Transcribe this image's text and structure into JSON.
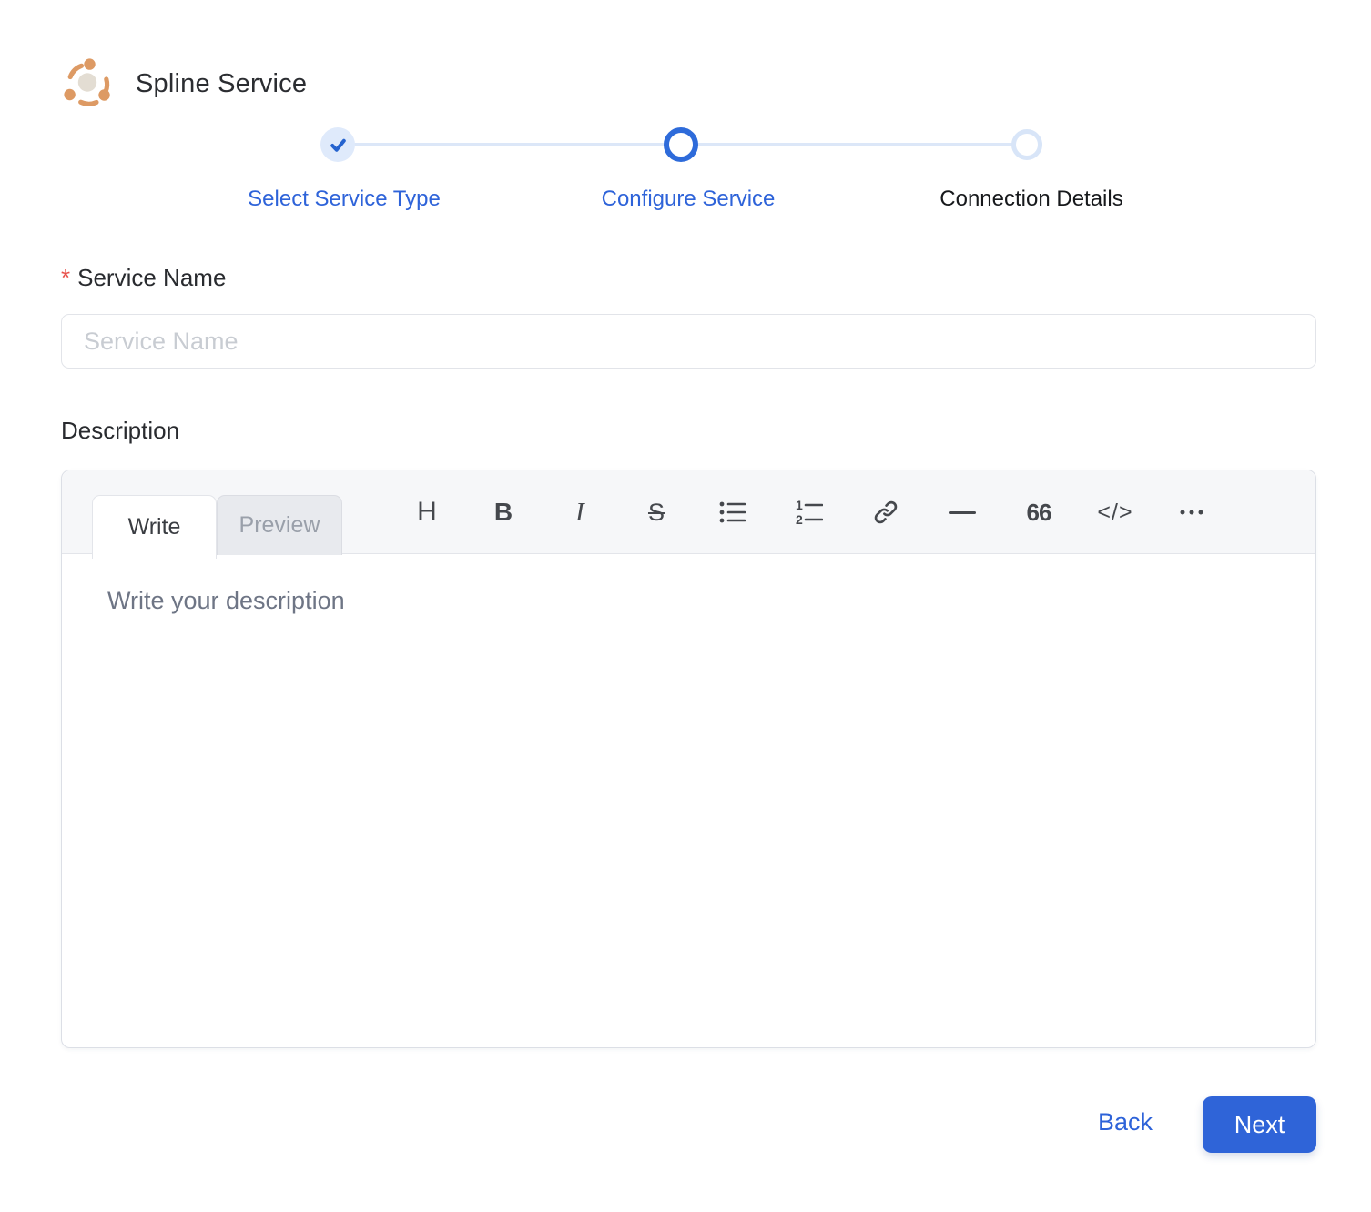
{
  "brand": {
    "title": "Spline Service",
    "logo_icon": "spline-hub-icon"
  },
  "stepper": {
    "steps": [
      {
        "label": "Select Service Type",
        "state": "completed",
        "icon": "check-icon"
      },
      {
        "label": "Configure Service",
        "state": "active",
        "icon": "ring-icon"
      },
      {
        "label": "Connection Details",
        "state": "upcoming",
        "icon": "ring-icon"
      }
    ]
  },
  "form": {
    "service_name": {
      "label": "Service Name",
      "required_marker": "*",
      "placeholder": "Service Name",
      "value": ""
    },
    "description": {
      "label": "Description",
      "editor": {
        "tabs": [
          {
            "label": "Write",
            "active": true
          },
          {
            "label": "Preview",
            "active": false
          }
        ],
        "toolbar": [
          {
            "name": "heading",
            "glyph": "H"
          },
          {
            "name": "bold",
            "glyph": "B"
          },
          {
            "name": "italic",
            "glyph": "I"
          },
          {
            "name": "strikethrough",
            "glyph": "S"
          },
          {
            "name": "unordered-list",
            "glyph": ""
          },
          {
            "name": "ordered-list",
            "glyph": ""
          },
          {
            "name": "link",
            "glyph": ""
          },
          {
            "name": "horizontal-rule",
            "glyph": ""
          },
          {
            "name": "quote",
            "glyph": "66"
          },
          {
            "name": "code",
            "glyph": "</>"
          },
          {
            "name": "more-options",
            "glyph": ""
          }
        ],
        "placeholder": "Write your description",
        "value": ""
      }
    }
  },
  "footer": {
    "back_label": "Back",
    "next_label": "Next"
  },
  "colors": {
    "accent_blue": "#2e64d8",
    "step_track_blue": "#dce7f8",
    "step_done_bg": "#dfeafb",
    "logo_orange": "#dd9a64",
    "required_red": "#e8504a"
  }
}
